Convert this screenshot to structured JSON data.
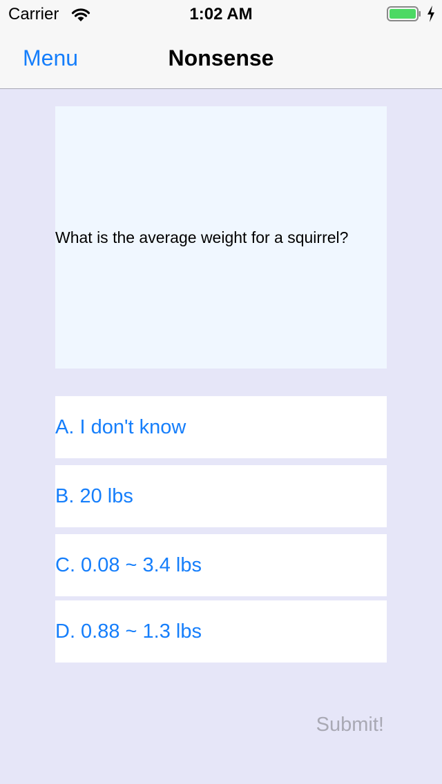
{
  "status_bar": {
    "carrier": "Carrier",
    "time": "1:02 AM",
    "battery_color": "#4cd964"
  },
  "nav": {
    "back_label": "Menu",
    "title": "Nonsense"
  },
  "quiz": {
    "question": "What is the average weight for a squirrel?",
    "answers": [
      "A. I don't know",
      "B. 20 lbs",
      "C. 0.08 ~ 3.4 lbs",
      "D. 0.88 ~ 1.3 lbs"
    ],
    "submit_label": "Submit!"
  },
  "colors": {
    "accent": "#157efb",
    "background": "#e6e6f8",
    "question_card": "#f0f7ff",
    "submit_disabled": "#a9a9b4"
  }
}
